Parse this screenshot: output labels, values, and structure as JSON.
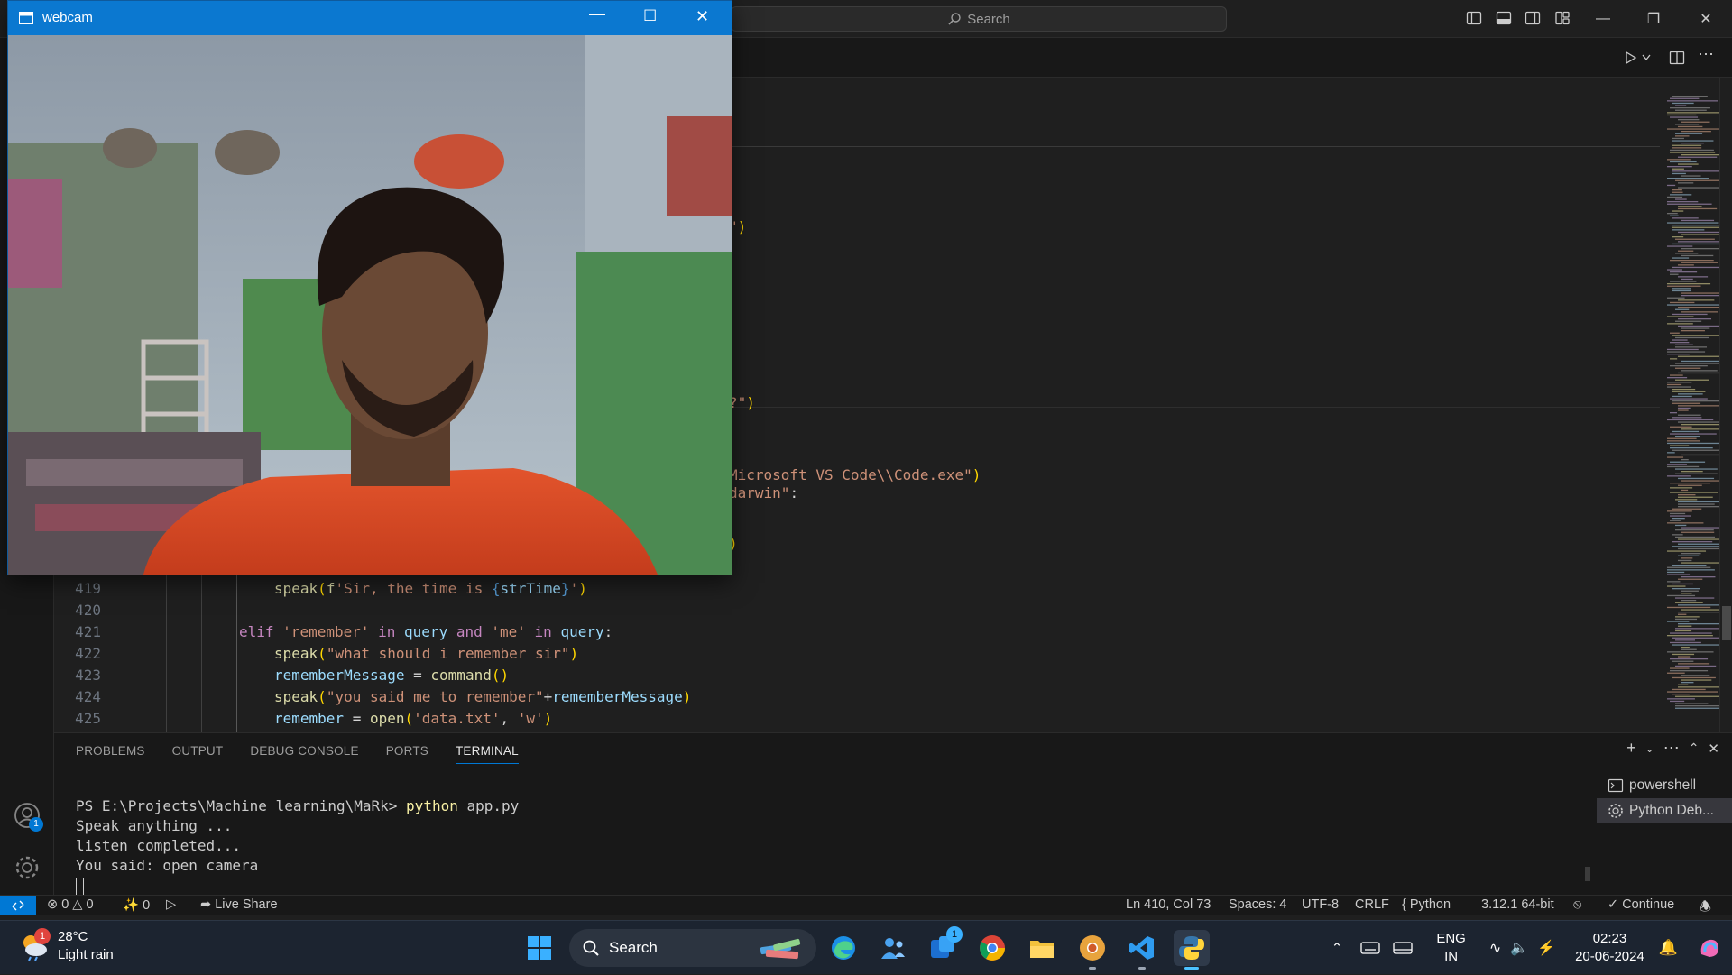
{
  "titlebar": {
    "search_placeholder": "Search"
  },
  "editor": {
    "lines": [
      {
        "n": "419",
        "tokens": [
          [
            "fn",
            "speak"
          ],
          [
            "paren",
            "("
          ],
          [
            "fn",
            "f"
          ],
          [
            "str",
            "'Sir, the time is "
          ],
          [
            "fstr-brace",
            "{"
          ],
          [
            "var",
            "strTime"
          ],
          [
            "fstr-brace",
            "}"
          ],
          [
            "str",
            "'"
          ],
          [
            "paren",
            ")"
          ]
        ],
        "indent": 4
      },
      {
        "n": "420",
        "tokens": [],
        "indent": 0
      },
      {
        "n": "421",
        "tokens": [
          [
            "kw",
            "elif "
          ],
          [
            "str",
            "'remember'"
          ],
          [
            "kw",
            " in "
          ],
          [
            "var",
            "query"
          ],
          [
            "kw",
            " and "
          ],
          [
            "str",
            "'me'"
          ],
          [
            "kw",
            " in "
          ],
          [
            "var",
            "query"
          ],
          [
            "op",
            ":"
          ]
        ],
        "indent": 3
      },
      {
        "n": "422",
        "tokens": [
          [
            "fn",
            "speak"
          ],
          [
            "paren",
            "("
          ],
          [
            "str",
            "\"what should i remember sir\""
          ],
          [
            "paren",
            ")"
          ]
        ],
        "indent": 4
      },
      {
        "n": "423",
        "tokens": [
          [
            "var",
            "rememberMessage"
          ],
          [
            "op",
            " = "
          ],
          [
            "fn",
            "command"
          ],
          [
            "paren",
            "()"
          ]
        ],
        "indent": 4
      },
      {
        "n": "424",
        "tokens": [
          [
            "fn",
            "speak"
          ],
          [
            "paren",
            "("
          ],
          [
            "str",
            "\"you said me to remember\""
          ],
          [
            "op",
            "+"
          ],
          [
            "var",
            "rememberMessage"
          ],
          [
            "paren",
            ")"
          ]
        ],
        "indent": 4
      },
      {
        "n": "425",
        "tokens": [
          [
            "var",
            "remember"
          ],
          [
            "op",
            " = "
          ],
          [
            "fn",
            "open"
          ],
          [
            "paren",
            "("
          ],
          [
            "str",
            "'data.txt'"
          ],
          [
            "op",
            ", "
          ],
          [
            "str",
            "'w'"
          ],
          [
            "paren",
            ")"
          ]
        ],
        "indent": 4
      }
    ],
    "partial_lines": [
      {
        "tokens": [
          [
            "str",
            "\""
          ],
          [
            "paren",
            ")"
          ]
        ]
      },
      {
        "tokens": [
          [
            "str",
            "?\""
          ],
          [
            "paren",
            ")"
          ]
        ]
      },
      {
        "tokens": [
          [
            "str",
            "Microsoft VS Code\\\\Code.exe\""
          ],
          [
            "paren",
            ")"
          ]
        ]
      },
      {
        "tokens": [
          [
            "str",
            "darwin\""
          ],
          [
            "op",
            ":"
          ]
        ]
      },
      {
        "tokens": [
          [
            "paren",
            ")"
          ]
        ]
      }
    ]
  },
  "panel": {
    "tabs": [
      "PROBLEMS",
      "OUTPUT",
      "DEBUG CONSOLE",
      "PORTS",
      "TERMINAL"
    ],
    "active_tab": "TERMINAL",
    "terminal": {
      "prompt": "PS E:\\Projects\\Machine learning\\MaRk> ",
      "command": "python",
      "args": " app.py",
      "output": [
        "Speak anything ...",
        "listen completed...",
        "You said: open camera"
      ]
    },
    "terminals": [
      "powershell",
      "Python Deb..."
    ]
  },
  "statusbar": {
    "errors": "0",
    "warnings": "0",
    "ports": "0",
    "live_share": "Live Share",
    "position": "Ln 410, Col 73",
    "spaces": "Spaces: 4",
    "encoding": "UTF-8",
    "eol": "CRLF",
    "language": "Python",
    "interpreter": "3.12.1 64-bit",
    "continue": "Continue"
  },
  "activitybar": {
    "accounts_badge": "1"
  },
  "webcam": {
    "title": "webcam"
  },
  "taskbar": {
    "weather_badge": "1",
    "temperature": "28°C",
    "weather": "Light rain",
    "search_label": "Search",
    "teams_badge": "1",
    "lang_top": "ENG",
    "lang_bottom": "IN",
    "time": "02:23",
    "date": "20-06-2024"
  },
  "colors": {
    "accent": "#0078d4",
    "webcam_titlebar": "#0b78d0",
    "string": "#ce9178",
    "keyword": "#c586c0",
    "function": "#dcdcaa",
    "variable": "#9cdcfe"
  }
}
